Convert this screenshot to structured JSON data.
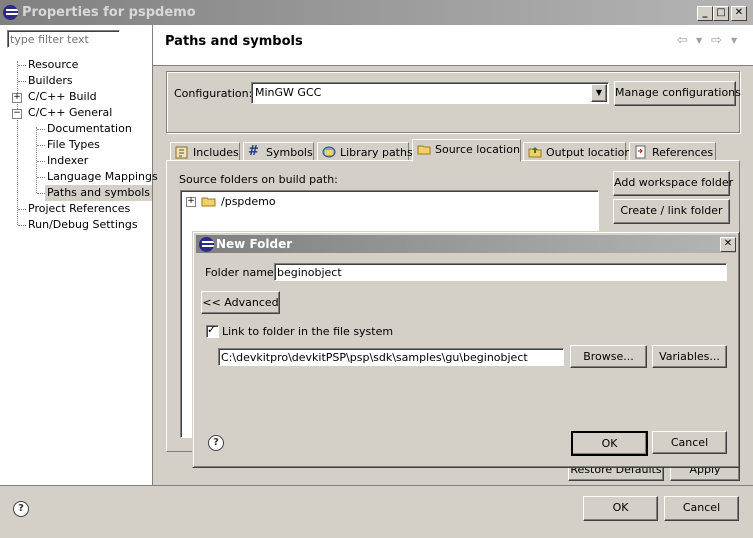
{
  "window": {
    "title": "Properties for pspdemo",
    "controls": [
      "_",
      "□",
      "✕"
    ]
  },
  "filter": {
    "placeholder": "type filter text"
  },
  "tree": [
    {
      "label": "Resource"
    },
    {
      "label": "Builders"
    },
    {
      "label": "C/C++ Build"
    },
    {
      "label": "C/C++ General"
    },
    {
      "label": "Documentation"
    },
    {
      "label": "File Types"
    },
    {
      "label": "Indexer"
    },
    {
      "label": "Language Mappings"
    },
    {
      "label": "Paths and symbols"
    },
    {
      "label": "Project References"
    },
    {
      "label": "Run/Debug Settings"
    }
  ],
  "page": {
    "title": "Paths and symbols",
    "configuration_label": "Configuration:",
    "configuration_value": "MinGW GCC",
    "manage_button": "Manage configurations",
    "tabs": [
      {
        "label": "Includes",
        "icon": "includes-icon"
      },
      {
        "label": "Symbols",
        "icon": "hash-icon"
      },
      {
        "label": "Library paths",
        "icon": "library-icon"
      },
      {
        "label": "Source location",
        "icon": "folder-icon"
      },
      {
        "label": "Output location",
        "icon": "output-folder-icon"
      },
      {
        "label": "References",
        "icon": "references-icon"
      }
    ],
    "active_tab": "Source location",
    "source_folders_label": "Source folders on build path:",
    "source_item": "/pspdemo",
    "add_workspace_button": "Add workspace folder",
    "create_link_button": "Create / link folder",
    "restore_button": "Restore Defaults",
    "apply_button": "Apply"
  },
  "dialog": {
    "title": "New Folder",
    "folder_name_label": "Folder name:",
    "folder_name_value": "beginobject",
    "advanced_button": "<< Advanced",
    "link_checkbox_label": "Link to folder in the file system",
    "link_checked": true,
    "link_path": "C:\\devkitpro\\devkitPSP\\psp\\sdk\\samples\\gu\\beginobject",
    "browse_button": "Browse...",
    "variables_button": "Variables...",
    "ok_button": "OK",
    "cancel_button": "Cancel"
  },
  "footer": {
    "ok_button": "OK",
    "cancel_button": "Cancel"
  }
}
